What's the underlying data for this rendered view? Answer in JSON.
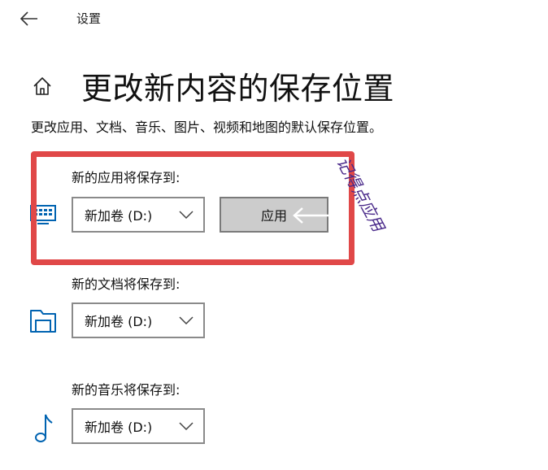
{
  "window": {
    "title": "设置"
  },
  "page": {
    "title": "更改新内容的保存位置",
    "description": "更改应用、文档、音乐、图片、视频和地图的默认保存位置。"
  },
  "sections": [
    {
      "label": "新的应用将保存到:",
      "selected": "新加卷 (D:)",
      "icon": "monitor-icon",
      "button": "应用"
    },
    {
      "label": "新的文档将保存到:",
      "selected": "新加卷 (D:)",
      "icon": "folder-icon"
    },
    {
      "label": "新的音乐将保存到:",
      "selected": "新加卷 (D:)",
      "icon": "music-note-icon"
    }
  ],
  "annotation": {
    "text": "记得点应用",
    "color": "#4a2a8a",
    "box_color": "#e04848"
  },
  "colors": {
    "accent": "#0063b1"
  }
}
